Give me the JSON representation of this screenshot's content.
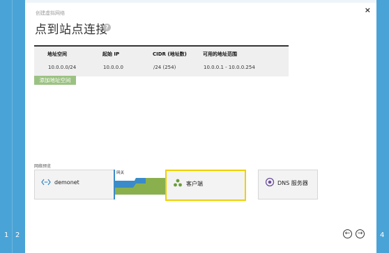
{
  "wizard": {
    "subtitle": "创建虚拟网络",
    "title": "点到站点连接",
    "help_icon": "?",
    "close_icon": "×",
    "steps_left": [
      "1",
      "2"
    ],
    "steps_right": [
      "4"
    ]
  },
  "address_table": {
    "headers": [
      "地址空间",
      "起始 IP",
      "CIDR (地址数)",
      "可用的地址范围"
    ],
    "row": [
      "10.0.0.0/24",
      "10.0.0.0",
      "/24 (254)",
      "10.0.0.1 - 10.0.0.254"
    ],
    "add_button": "添加地址空间"
  },
  "preview": {
    "label": "网络预览",
    "vnet": "demonet",
    "gateway": "网关",
    "client": "客户端",
    "dns": "DNS 服务器"
  },
  "nav": {
    "prev": "←",
    "next": "→"
  },
  "colors": {
    "side_strip": "#4aa3d6",
    "add_button": "#9cc283",
    "client_border": "#f0d000",
    "conn_green": "#8ab04e",
    "conn_blue": "#3a8bc9"
  }
}
